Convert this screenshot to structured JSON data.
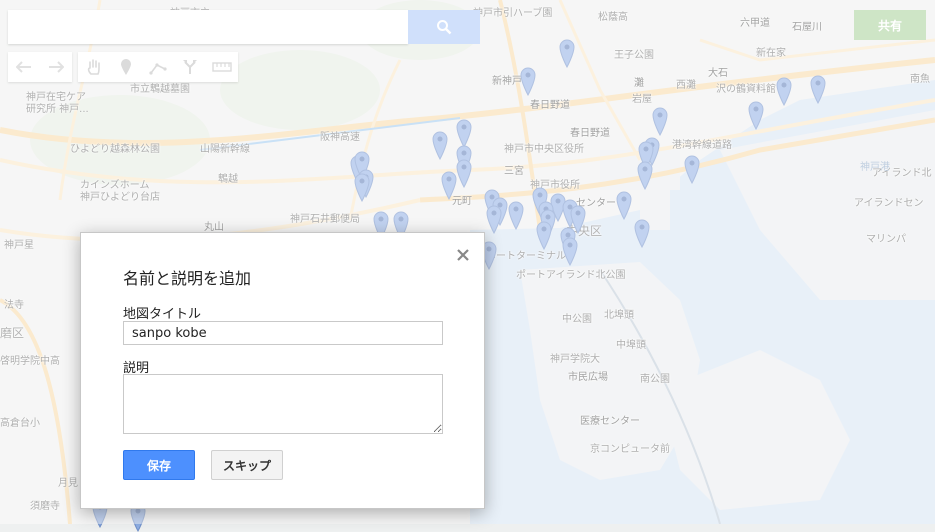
{
  "search": {
    "placeholder": "",
    "value": ""
  },
  "toolbar": {
    "tools": [
      "undo-icon",
      "redo-icon",
      "hand-icon",
      "marker-icon",
      "line-icon",
      "route-icon",
      "ruler-icon"
    ]
  },
  "share": {
    "label": "共有"
  },
  "map": {
    "labels": [
      {
        "text": "神戸市立...",
        "cls": ""
      },
      {
        "text": "王子公園",
        "cls": ""
      },
      {
        "text": "松蔭高",
        "cls": ""
      },
      {
        "text": "神戸市引ハーブ園",
        "cls": ""
      },
      {
        "text": "六甲道",
        "cls": "dark"
      },
      {
        "text": "石屋川",
        "cls": "dark"
      },
      {
        "text": "新在家",
        "cls": ""
      },
      {
        "text": "大石",
        "cls": "dark"
      },
      {
        "text": "南魚",
        "cls": ""
      },
      {
        "text": "灘",
        "cls": "dark"
      },
      {
        "text": "西灘",
        "cls": ""
      },
      {
        "text": "岩屋",
        "cls": ""
      },
      {
        "text": "沢の鶴資料館",
        "cls": ""
      },
      {
        "text": "新神戸",
        "cls": "dark"
      },
      {
        "text": "春日野道",
        "cls": "dark"
      },
      {
        "text": "春日野道",
        "cls": "dark"
      },
      {
        "text": "神戸在宅ケア",
        "cls": ""
      },
      {
        "text": "研究所 神戸...",
        "cls": ""
      },
      {
        "text": "市立鵯越墓園",
        "cls": ""
      },
      {
        "text": "ひよどり越森林公園",
        "cls": ""
      },
      {
        "text": "神戸市中央区役所",
        "cls": ""
      },
      {
        "text": "三宮",
        "cls": "dark"
      },
      {
        "text": "神戸市役所",
        "cls": ""
      },
      {
        "text": "元町",
        "cls": "dark"
      },
      {
        "text": "センター",
        "cls": "dark"
      },
      {
        "text": "中央区",
        "cls": "big"
      },
      {
        "text": "鵯越",
        "cls": ""
      },
      {
        "text": "カインズホーム",
        "cls": ""
      },
      {
        "text": "神戸ひよどり台店",
        "cls": ""
      },
      {
        "text": "丸山",
        "cls": "dark"
      },
      {
        "text": "神戸石井郵便局",
        "cls": ""
      },
      {
        "text": "神戸星",
        "cls": ""
      },
      {
        "text": "ポートターミナル",
        "cls": ""
      },
      {
        "text": "ポートアイランド北公園",
        "cls": ""
      },
      {
        "text": "中公園",
        "cls": ""
      },
      {
        "text": "北埠頭",
        "cls": ""
      },
      {
        "text": "中埠頭",
        "cls": ""
      },
      {
        "text": "神戸学院大",
        "cls": ""
      },
      {
        "text": "市民広場",
        "cls": "dark"
      },
      {
        "text": "南公園",
        "cls": ""
      },
      {
        "text": "医療センター",
        "cls": "dark"
      },
      {
        "text": "京コンピュータ前",
        "cls": ""
      },
      {
        "text": "アイランド北",
        "cls": ""
      },
      {
        "text": "アイランドセン",
        "cls": ""
      },
      {
        "text": "マリンパ",
        "cls": ""
      },
      {
        "text": "神戸港",
        "cls": "water"
      },
      {
        "text": "磨区",
        "cls": "big"
      },
      {
        "text": "啓明学院中高",
        "cls": ""
      },
      {
        "text": "須磨寺",
        "cls": ""
      },
      {
        "text": "月見",
        "cls": ""
      },
      {
        "text": "山陽新幹線",
        "cls": ""
      },
      {
        "text": "阪神高速",
        "cls": ""
      },
      {
        "text": "港湾幹線道路",
        "cls": ""
      },
      {
        "text": "法寺",
        "cls": ""
      },
      {
        "text": "高倉台小",
        "cls": ""
      }
    ]
  },
  "dialog": {
    "title": "名前と説明を追加",
    "map_title_label": "地図タイトル",
    "map_title_value": "sanpo kobe",
    "description_label": "説明",
    "description_value": "",
    "save_label": "保存",
    "skip_label": "スキップ"
  },
  "colors": {
    "accent": "#4d90fe",
    "share": "#a6cf98",
    "search_button": "#a9c7f7",
    "marker": "#8eaee3"
  }
}
